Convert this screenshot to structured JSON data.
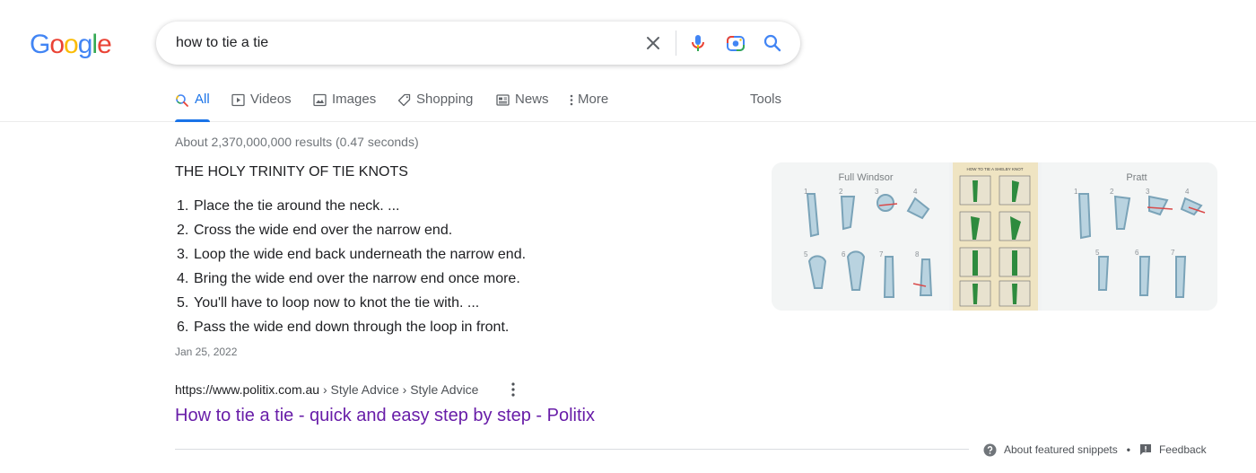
{
  "logo": {
    "letters": [
      "G",
      "o",
      "o",
      "g",
      "l",
      "e"
    ]
  },
  "search": {
    "query": "how to tie a tie"
  },
  "tabs": [
    {
      "label": "All",
      "icon": "search-icon",
      "active": true
    },
    {
      "label": "Videos",
      "icon": "video-icon"
    },
    {
      "label": "Images",
      "icon": "image-icon"
    },
    {
      "label": "Shopping",
      "icon": "tag-icon"
    },
    {
      "label": "News",
      "icon": "news-icon"
    },
    {
      "label": "More",
      "icon": "more-vert-icon"
    }
  ],
  "tools_label": "Tools",
  "stats": "About 2,370,000,000 results (0.47 seconds)",
  "snippet": {
    "heading": "THE HOLY TRINITY OF TIE KNOTS",
    "steps": [
      {
        "num": "1.",
        "text": "Place the tie around the neck. ..."
      },
      {
        "num": "2.",
        "text": "Cross the wide end over the narrow end."
      },
      {
        "num": "3.",
        "text": "Loop the wide end back underneath the narrow end."
      },
      {
        "num": "4.",
        "text": "Bring the wide end over the narrow end once more."
      },
      {
        "num": "5.",
        "text": "You'll have to loop now to knot the tie with. ..."
      },
      {
        "num": "6.",
        "text": "Pass the wide end down through the loop in front."
      }
    ],
    "date": "Jan 25, 2022",
    "images": [
      {
        "caption": "Full Windsor"
      },
      {
        "caption": "HOW TO TIE A SHELBY KNOT"
      },
      {
        "caption": "Pratt"
      }
    ]
  },
  "result": {
    "url": "https://www.politix.com.au",
    "breadcrumb": " › Style Advice › Style Advice",
    "title": "How to tie a tie - quick and easy step by step - Politix"
  },
  "footer": {
    "about_snippets": "About featured snippets",
    "feedback": "Feedback"
  },
  "colors": {
    "google_blue": "#4285f4",
    "google_red": "#ea4335",
    "google_yellow": "#fbbc05",
    "google_green": "#34a853",
    "active_tab": "#1a73e8",
    "visited_link": "#681da8"
  }
}
